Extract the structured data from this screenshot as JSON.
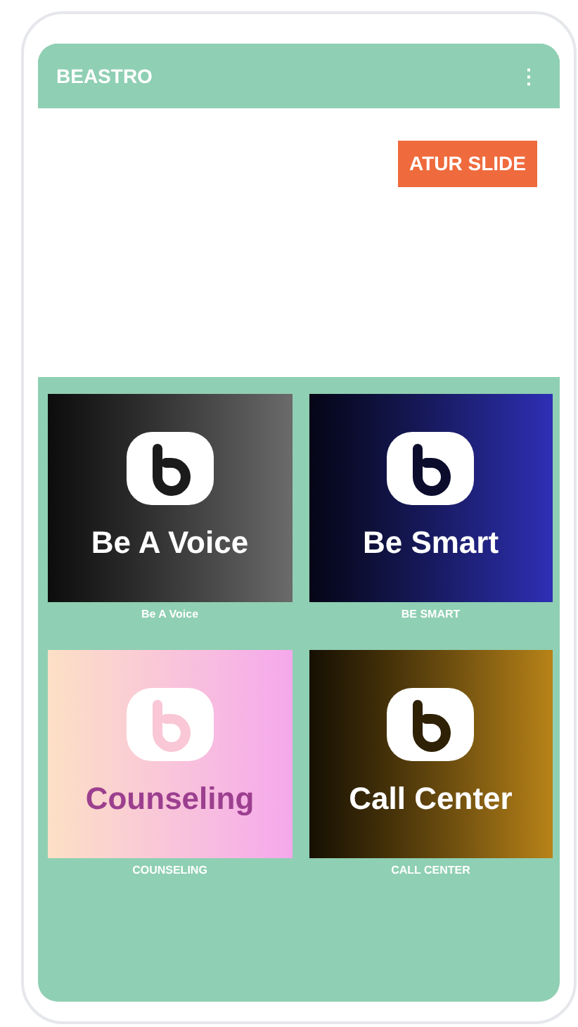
{
  "app_bar": {
    "title": "BEASTRO",
    "menu": "⋮"
  },
  "banner": {
    "button": "ATUR SLIDE"
  },
  "tiles": [
    {
      "title": "Be A Voice",
      "caption": "Be A Voice",
      "color": "#6b6b6b"
    },
    {
      "title": "Be Smart",
      "caption": "BE SMART",
      "color": "#2e2fb5"
    },
    {
      "title": "Counseling",
      "caption": "COUNSELING",
      "color": "#f5a8ec"
    },
    {
      "title": "Call Center",
      "caption": "CALL CENTER",
      "color": "#b88318"
    }
  ]
}
